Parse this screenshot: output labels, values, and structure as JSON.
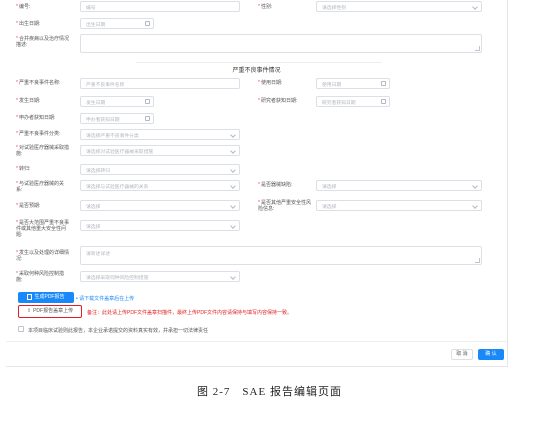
{
  "top": {
    "id_label": "编号:",
    "id_placeholder": "编号",
    "gender_label": "性别:",
    "gender_placeholder": "请选择性别",
    "birth_label": "出生日期:",
    "birth_placeholder": "出生日期",
    "history_label": "合并疾病以及治疗情况\n描述:"
  },
  "section_title": "严重不良事件情况",
  "form": {
    "sae_name": {
      "label": "严重不良事件名称:",
      "placeholder": "严重不良事件名称"
    },
    "use_date": {
      "label": "使用日期:",
      "placeholder": "使用日期"
    },
    "occur_date": {
      "label": "发生日期:",
      "placeholder": "发生日期"
    },
    "aware_date": {
      "label": "研究者获知日期:",
      "placeholder": "研究者获知日期"
    },
    "sponsor_aware_date": {
      "label": "申办者获知日期:",
      "placeholder": "申办者获知日期"
    },
    "sae_category": {
      "label": "严重不良事件分类:",
      "placeholder": "请选择严重不良事件分类"
    },
    "device_measures": {
      "label": "对试验医疗器械采取措\n施:",
      "placeholder": "请选择对试验医疗器械采取措施"
    },
    "outcome": {
      "label": "转归:",
      "placeholder": "请选择转归"
    },
    "relation": {
      "label": "与试验医疗器械的关\n系:",
      "placeholder": "请选择与试验医疗器械的关系"
    },
    "device_defect": {
      "label": "是否器械缺陷:",
      "placeholder": "请选择"
    },
    "expected": {
      "label": "是否预期:",
      "placeholder": "请选择"
    },
    "other_risk": {
      "label": "是否其他严重安全性风\n险信息:",
      "placeholder": "请选择"
    },
    "wide_risk": {
      "label": "是否大范围严重不良事\n件或其他重大安全性问\n题:",
      "placeholder": "请选择"
    },
    "details": {
      "label": "发生以及处理的详细情\n况:",
      "placeholder": "请简述详述"
    },
    "risk_control": {
      "label": "采取何种风险控制措\n施:",
      "placeholder": "请选择采取何种风险控制措施"
    }
  },
  "actions": {
    "generate_pdf": "生成PDF报告",
    "download_hint": "请下载文件盖章后在上传",
    "upload_pdf": "PDF报告盖章上传",
    "note": "备注：此处请上传PDF文件盖章扫描件，最终上传PDF文件内容请保持与填写内容保持一致。",
    "confirm_check": "本项目临床试验则此报告，本企业承诺提交的资料真实有效，并承担一切法律责任",
    "cancel": "取 消",
    "ok": "确 认"
  },
  "caption": "图 2-7　SAE 报告编辑页面",
  "colors": {
    "primary": "#1989fa",
    "required": "#f0443b",
    "note_red": "#e02020",
    "highlight_border": "#e02020"
  }
}
